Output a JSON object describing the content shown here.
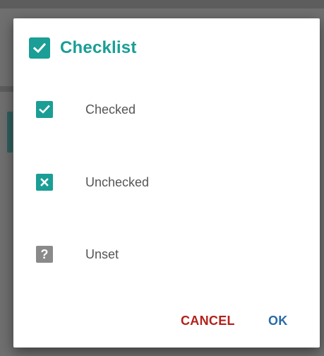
{
  "dialog": {
    "title": "Checklist",
    "title_icon": "checkbox-checked-icon",
    "items": [
      {
        "label": "Checked",
        "state": "checked",
        "icon": "check-icon"
      },
      {
        "label": "Unchecked",
        "state": "unchecked",
        "icon": "x-icon"
      },
      {
        "label": "Unset",
        "state": "unset",
        "icon_text": "?"
      }
    ],
    "buttons": {
      "cancel": "CANCEL",
      "ok": "OK"
    }
  },
  "colors": {
    "accent": "#1a9e95",
    "cancel": "#b3211b",
    "ok": "#2b6aa8",
    "unset": "#8a8a8a"
  }
}
